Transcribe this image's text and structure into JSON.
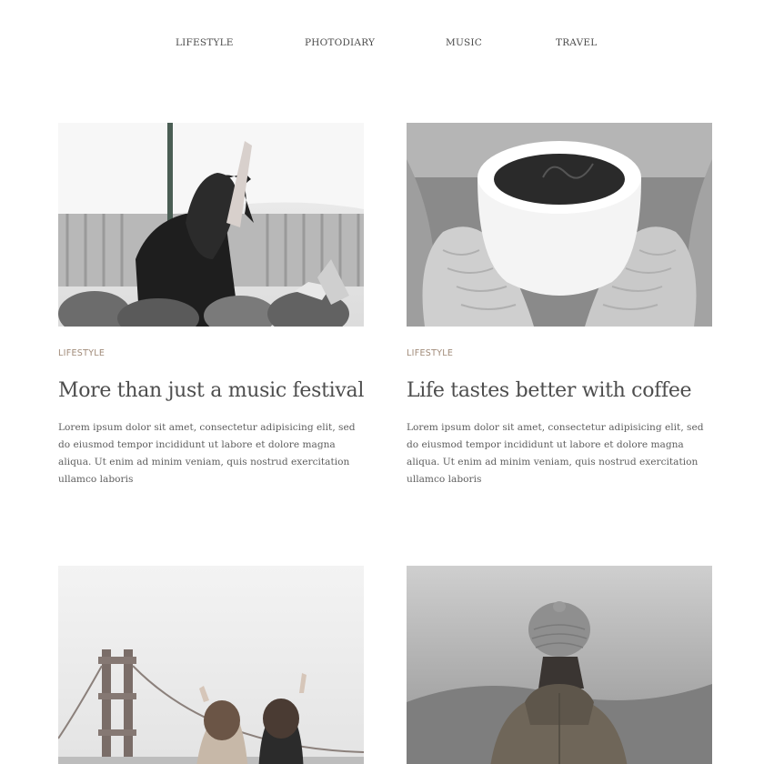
{
  "nav": {
    "items": [
      {
        "label": "LIFESTYLE"
      },
      {
        "label": "PHOTODIARY"
      },
      {
        "label": "MUSIC"
      },
      {
        "label": "TRAVEL"
      }
    ]
  },
  "posts": [
    {
      "image_alt": "Woman at a music festival crowd",
      "category": "LIFESTYLE",
      "title": "More than just a music festival",
      "excerpt": "Lorem ipsum dolor sit amet, consectetur adipisicing elit, sed do eiusmod tempor incididunt ut labore et dolore magna aliqua. Ut enim ad minim veniam, quis nostrud exercitation ullamco laboris"
    },
    {
      "image_alt": "Hands in knitted mittens holding a cup of coffee",
      "category": "LIFESTYLE",
      "title": "Life tastes better with coffee",
      "excerpt": "Lorem ipsum dolor sit amet, consectetur adipisicing elit, sed do eiusmod tempor incididunt ut labore et dolore magna aliqua. Ut enim ad minim veniam, quis nostrud exercitation ullamco laboris"
    },
    {
      "image_alt": "Two friends raising peace signs near a bridge"
    },
    {
      "image_alt": "Person in a beanie and hooded jacket facing misty landscape"
    }
  ]
}
